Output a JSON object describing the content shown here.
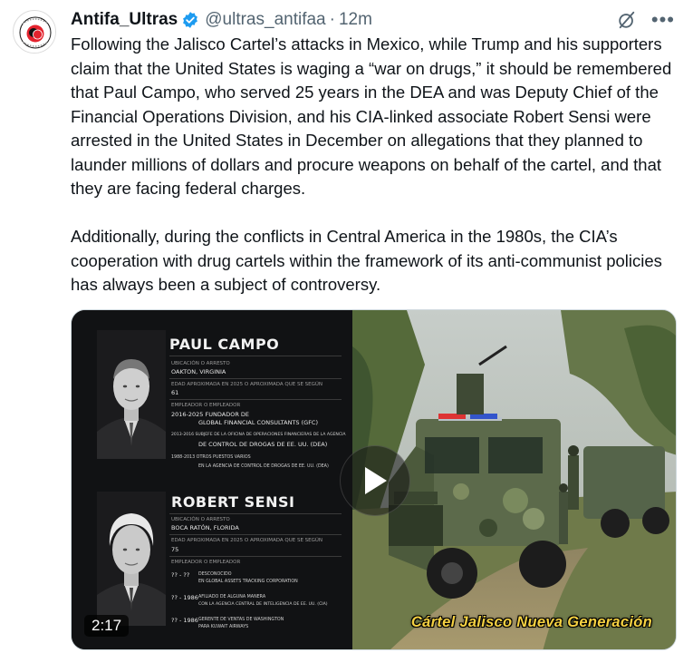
{
  "tweet": {
    "display_name": "Antifa_Ultras",
    "handle": "@ultras_antifaa",
    "separator": "·",
    "timestamp": "12m",
    "more_label": "•••",
    "paragraphs": [
      "Following the Jalisco Cartel’s attacks in Mexico, while Trump and his supporters claim that the United States is waging a “war on drugs,” it should be remembered that Paul Campo, who served 25 years in the DEA and was Deputy Chief of the Financial Operations Division, and his CIA-linked associate Robert Sensi were arrested in the United States in December on allegations that they planned to launder millions of dollars and procure weapons on behalf of the cartel, and that they are facing federal charges.",
      "Additionally, during the conflicts in Central America in the 1980s, the CIA’s cooperation with drug cartels within the framework of its anti-communist policies has always been a subject of controversy."
    ]
  },
  "media": {
    "duration": "2:17",
    "caption": "Cártel Jalisco Nueva Generación",
    "dossier": {
      "person1": {
        "name": "PAUL CAMPO",
        "location_label": "Ubicación o Arresto",
        "location": "Oakton, Virginia",
        "age_label": "Edad aproximada en 2025 o aproximada que se según",
        "age": "61",
        "jobs_label": "Empleador o Empleador",
        "jobs": [
          "2016-2025 Fundador de",
          "Global Financial Consultants (GFC)",
          "2013-2016 Subjefe de la Oficina de Operaciones Financieras de la Agencia",
          "de Control de Drogas de EE. UU. (DEA)",
          "1988-2013 Otros puestos varios",
          "en la Agencia de Control de Drogas de EE. UU. (DEA)"
        ]
      },
      "person2": {
        "name": "ROBERT SENSI",
        "location_label": "Ubicación o Arresto",
        "location": "Boca Ratón, Florida",
        "age_label": "Edad aproximada en 2025 o aproximada que se según",
        "age": "75",
        "jobs_label": "Empleador o Empleador",
        "jobs": [
          "?? - ??",
          "Desconocido",
          "en Global Assets Tracking Corporation",
          "?? - 1986",
          "Afiliado de alguna manera",
          "con la Agencia Central de Inteligencia de EE. UU. (CIA)",
          "?? - 1986",
          "Gerente de ventas de Washington",
          "para Kuwait Airways"
        ]
      }
    }
  },
  "colors": {
    "text": "#0f1419",
    "secondary": "#536471",
    "verified": "#1d9bf0",
    "caption": "#f5d142",
    "avatar_red": "#e3232e"
  },
  "icons": {
    "verified": "verified-badge-icon",
    "grok": "grok-icon",
    "more": "more-icon",
    "play": "play-icon"
  }
}
